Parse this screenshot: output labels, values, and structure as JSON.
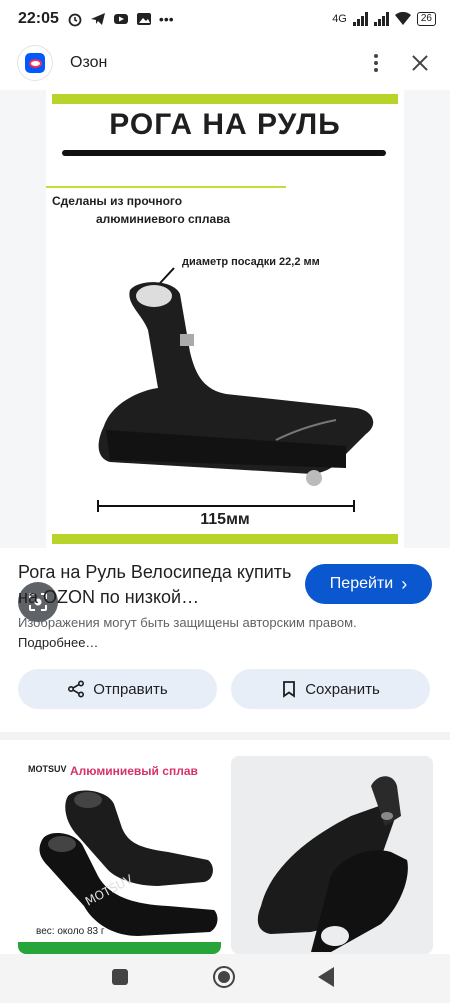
{
  "status_bar": {
    "time": "22:05",
    "network": "4G",
    "battery": "26"
  },
  "header": {
    "app_name": "Озон"
  },
  "product_image": {
    "title": "РОГА НА РУЛЬ",
    "note_line1": "Сделаны из прочного",
    "note_line2": "алюминиевого сплава",
    "diameter": "диаметр посадки  22,2 мм",
    "dimension": "115мм"
  },
  "result": {
    "title": "Рога на Руль Велосипеда купить на OZON по низкой…",
    "goto_label": "Перейти",
    "copyright_text": "Изображения могут быть защищены авторским правом.",
    "more_link": "Подробнее…"
  },
  "actions": {
    "share_label": "Отправить",
    "save_label": "Сохранить"
  },
  "related": {
    "thumb1_title": "Алюминиевый сплав",
    "thumb1_logo": "MOTSUV",
    "thumb1_weight": "вес: около 83 г"
  },
  "colors": {
    "accent": "#0b57d0",
    "button_bg": "#e8eef8",
    "green_bar": "#b8d42a"
  }
}
